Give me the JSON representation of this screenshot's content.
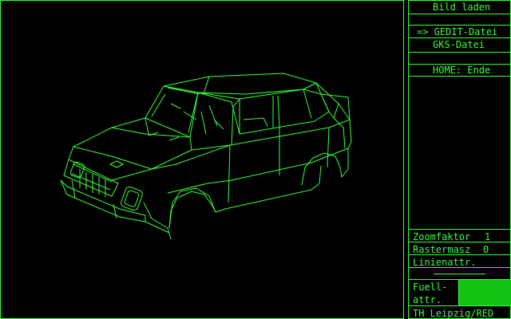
{
  "menu": {
    "title": "Bild laden",
    "items": [
      {
        "label": "=> GEDIT-Datei"
      },
      {
        "label": "GKS-Datei"
      },
      {
        "label": "HOME: Ende"
      }
    ]
  },
  "settings": {
    "zoom_label": "Zoomfaktor",
    "zoom_value": "1",
    "raster_label": "Rastermasz",
    "raster_value": "0",
    "line_attr_label": "Linienattr.",
    "fill_attr_label_1": "Fuell-",
    "fill_attr_label_2": "attr."
  },
  "footer": "TH Leipzig/RED",
  "colors": {
    "line": "#3cff3c",
    "fill_swatch": "#11c411",
    "background": "#000000"
  },
  "canvas_content": "car-wireframe"
}
